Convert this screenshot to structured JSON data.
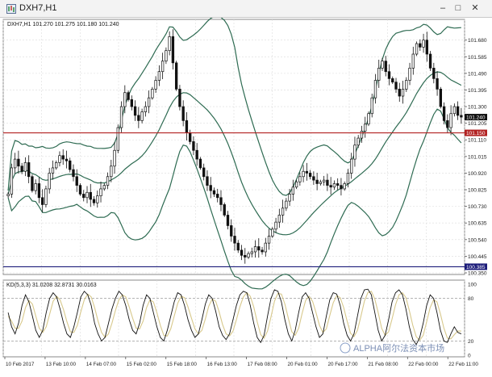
{
  "window": {
    "title": "DXH7,H1",
    "minimize_glyph": "–",
    "maximize_glyph": "□",
    "close_glyph": "✕",
    "icon": "chart-window-icon"
  },
  "header": {
    "symbol_info": "DXH7,H1  101.270 101.275 101.180 101.240"
  },
  "price_axis": {
    "labels": [
      "101.680",
      "101.585",
      "101.490",
      "101.395",
      "101.300",
      "101.205",
      "101.110",
      "101.015",
      "100.920",
      "100.825",
      "100.730",
      "100.635",
      "100.540",
      "100.445",
      "100.350"
    ],
    "current_price": "101.240",
    "hline_price": "101.150",
    "low_line_price": "100.385"
  },
  "indicator": {
    "label": "KD(5,3,3) 31.0208 32.8731 30.0163",
    "levels": [
      "100",
      "80",
      "20",
      "0"
    ]
  },
  "time_axis": {
    "labels": [
      "10 Feb 2017",
      "13 Feb 10:00",
      "14 Feb 07:00",
      "15 Feb 02:00",
      "15 Feb 18:00",
      "16 Feb 13:00",
      "17 Feb 08:00",
      "20 Feb 01:00",
      "20 Feb 17:00",
      "21 Feb 08:00",
      "22 Feb 00:00",
      "22 Feb 11:00"
    ]
  },
  "watermark": "ALPHA阿尔法资本市场",
  "colors": {
    "bull": "#111111",
    "band": "#2e6b52",
    "hline": "#b22222",
    "low_line": "#1c1c7a",
    "stoch_k": "#111111",
    "stoch_d": "#d8c98c",
    "grid": "#dcdcdc"
  },
  "chart_data": {
    "type": "candlestick",
    "title": "DXH7,H1",
    "ylim": [
      100.35,
      101.78
    ],
    "hlines": [
      101.15,
      100.385
    ],
    "candles_close": [
      100.8,
      100.95,
      101.0,
      100.96,
      100.93,
      100.98,
      100.9,
      100.82,
      100.86,
      100.78,
      100.74,
      100.83,
      100.92,
      100.95,
      100.98,
      101.02,
      101.0,
      100.99,
      100.94,
      100.9,
      100.85,
      100.8,
      100.78,
      100.81,
      100.77,
      100.75,
      100.79,
      100.83,
      100.85,
      100.9,
      100.96,
      101.05,
      101.18,
      101.3,
      101.38,
      101.34,
      101.3,
      101.25,
      101.22,
      101.27,
      101.3,
      101.35,
      101.4,
      101.45,
      101.5,
      101.56,
      101.62,
      101.7,
      101.55,
      101.4,
      101.3,
      101.22,
      101.15,
      101.1,
      101.05,
      101.0,
      100.95,
      100.9,
      100.85,
      100.82,
      100.8,
      100.78,
      100.74,
      100.68,
      100.62,
      100.56,
      100.52,
      100.48,
      100.45,
      100.44,
      100.46,
      100.47,
      100.5,
      100.48,
      100.47,
      100.52,
      100.56,
      100.6,
      100.64,
      100.68,
      100.72,
      100.76,
      100.8,
      100.84,
      100.87,
      100.9,
      100.93,
      100.92,
      100.9,
      100.88,
      100.86,
      100.87,
      100.88,
      100.85,
      100.84,
      100.86,
      100.85,
      100.83,
      100.86,
      100.92,
      101.0,
      101.08,
      101.12,
      101.16,
      101.2,
      101.26,
      101.35,
      101.45,
      101.52,
      101.56,
      101.5,
      101.46,
      101.44,
      101.4,
      101.36,
      101.4,
      101.45,
      101.52,
      101.6,
      101.66,
      101.64,
      101.68,
      101.6,
      101.52,
      101.46,
      101.4,
      101.3,
      101.22,
      101.18,
      101.26,
      101.3,
      101.25,
      101.24
    ],
    "stoch_k": [
      60,
      40,
      30,
      45,
      70,
      85,
      75,
      55,
      35,
      25,
      35,
      60,
      80,
      88,
      82,
      65,
      45,
      30,
      25,
      40,
      60,
      82,
      90,
      85,
      70,
      45,
      30,
      20,
      25,
      45,
      65,
      80,
      90,
      85,
      70,
      50,
      35,
      30,
      45,
      70,
      85,
      80,
      60,
      40,
      25,
      20,
      35,
      55,
      75,
      88,
      85,
      70,
      50,
      35,
      25,
      30,
      50,
      72,
      85,
      80,
      62,
      40,
      28,
      22,
      30,
      50,
      70,
      85,
      90,
      88,
      70,
      45,
      25,
      18,
      28,
      55,
      80,
      92,
      90,
      75,
      50,
      30,
      20,
      35,
      60,
      82,
      88,
      80,
      60,
      40,
      25,
      30,
      55,
      78,
      88,
      86,
      70,
      45,
      28,
      20,
      30,
      55,
      80,
      92,
      93,
      85,
      60,
      35,
      20,
      28,
      50,
      75,
      88,
      92,
      85,
      65,
      40,
      22,
      15,
      25,
      45,
      70,
      85,
      80,
      60,
      35,
      20,
      18,
      30,
      40,
      32,
      30
    ],
    "stoch_d": [
      55,
      48,
      38,
      38,
      48,
      67,
      77,
      72,
      55,
      38,
      32,
      40,
      58,
      76,
      83,
      78,
      64,
      47,
      33,
      32,
      42,
      61,
      78,
      86,
      82,
      67,
      48,
      32,
      25,
      30,
      45,
      63,
      78,
      85,
      82,
      68,
      52,
      38,
      37,
      48,
      67,
      78,
      75,
      60,
      42,
      28,
      27,
      37,
      55,
      73,
      83,
      81,
      68,
      52,
      37,
      30,
      35,
      51,
      69,
      79,
      76,
      61,
      43,
      30,
      27,
      34,
      50,
      68,
      82,
      88,
      83,
      68,
      47,
      29,
      24,
      34,
      54,
      76,
      87,
      86,
      72,
      52,
      33,
      28,
      38,
      59,
      77,
      83,
      76,
      60,
      42,
      32,
      37,
      56,
      74,
      84,
      81,
      67,
      48,
      31,
      26,
      35,
      55,
      76,
      88,
      90,
      79,
      60,
      38,
      28,
      33,
      51,
      71,
      85,
      88,
      81,
      63,
      42,
      26,
      21,
      28,
      47,
      67,
      78,
      75,
      58,
      38,
      24,
      23,
      29,
      34,
      34
    ]
  }
}
